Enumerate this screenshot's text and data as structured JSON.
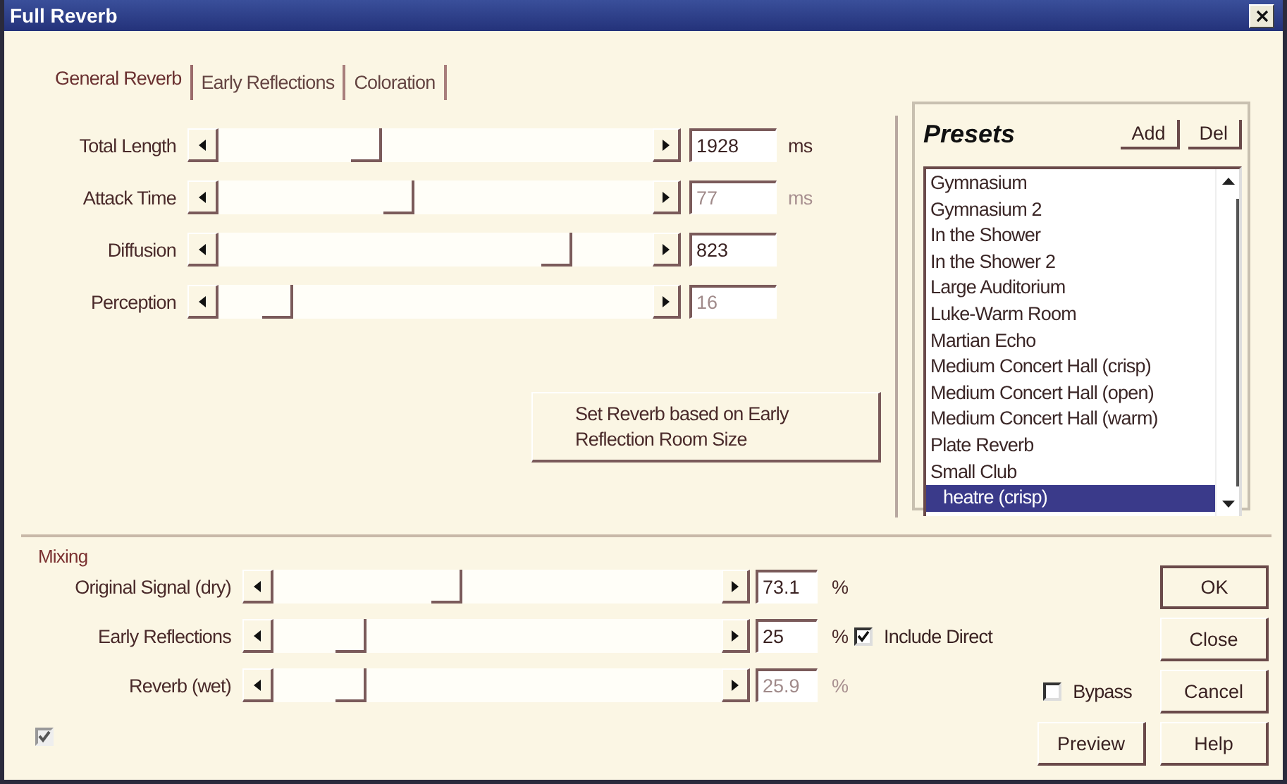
{
  "window": {
    "title": "Full Reverb"
  },
  "tabs": [
    {
      "label": "General Reverb",
      "selected": true
    },
    {
      "label": "Early Reflections",
      "selected": false
    },
    {
      "label": "Coloration",
      "selected": false
    }
  ],
  "sliders": [
    {
      "label": "Total Length",
      "level": 0.33,
      "value": "1928",
      "unit": "ms",
      "disabled": false
    },
    {
      "label": "Attack Time",
      "level": 0.41,
      "value": "77",
      "unit": "ms",
      "disabled": true
    },
    {
      "label": "Diffusion",
      "level": 0.8,
      "value": "823",
      "disabled": false
    },
    {
      "label": "Perception",
      "level": 0.11,
      "value": "16",
      "disabled": true
    }
  ],
  "set_reverb_button": "Set Reverb based on Early Reflection Room Size",
  "presets": {
    "title": "Presets",
    "add_button": "Add",
    "del_button": "Del",
    "items": [
      {
        "label": "Gymnasium",
        "selected": false
      },
      {
        "label": "Gymnasium 2",
        "selected": false
      },
      {
        "label": "In the Shower",
        "selected": false
      },
      {
        "label": "In the Shower 2",
        "selected": false
      },
      {
        "label": "Large Auditorium",
        "selected": false
      },
      {
        "label": "Luke-Warm Room",
        "selected": false
      },
      {
        "label": "Martian Echo",
        "selected": false
      },
      {
        "label": "Medium Concert Hall (crisp)",
        "selected": false
      },
      {
        "label": "Medium Concert Hall (open)",
        "selected": false
      },
      {
        "label": "Medium Concert Hall (warm)",
        "selected": false
      },
      {
        "label": "Plate Reverb",
        "selected": false
      },
      {
        "label": "Small Club",
        "selected": false
      },
      {
        "label": "heatre (crisp)",
        "selected": true
      }
    ]
  },
  "mixing": {
    "title": "Mixing",
    "sliders": [
      {
        "label": "Original Signal (dry)",
        "level": 0.38,
        "value": "73.1",
        "unit": "%",
        "disabled": false
      },
      {
        "label": "Early Reflections",
        "level": 0.15,
        "value": "25",
        "unit": "%",
        "disabled": false
      },
      {
        "label": "Reverb (wet)",
        "level": 0.15,
        "value": "25.9",
        "unit": "%",
        "disabled": true
      }
    ]
  },
  "include_direct": {
    "label": "Include Direct",
    "checked": true
  },
  "bypass": {
    "label": "Bypass",
    "checked": false
  },
  "greyed_checkbox": {
    "checked": true,
    "disabled": true
  },
  "buttons": [
    "OK",
    "Close",
    "Cancel"
  ],
  "preview_button": "Preview",
  "help_button": "Help"
}
